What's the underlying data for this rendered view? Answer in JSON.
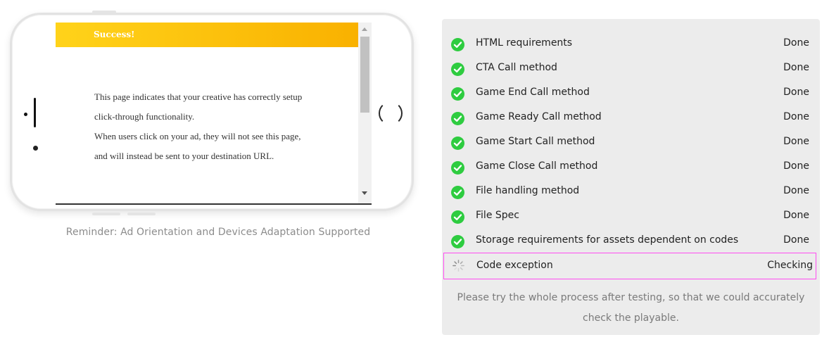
{
  "preview": {
    "header": "Success!",
    "body_lines": [
      "This page indicates that your creative has correctly setup",
      "click-through functionality.",
      "When users click on your ad, they will not see this page,",
      "and will instead be sent to your destination URL."
    ],
    "reminder": "Reminder: Ad Orientation and Devices Adaptation Supported"
  },
  "checks": {
    "items": [
      {
        "label": "HTML requirements",
        "status": "Done"
      },
      {
        "label": "CTA Call method",
        "status": "Done"
      },
      {
        "label": "Game End Call method",
        "status": "Done"
      },
      {
        "label": "Game Ready Call method",
        "status": "Done"
      },
      {
        "label": "Game Start Call method",
        "status": "Done"
      },
      {
        "label": "Game Close Call method",
        "status": "Done"
      },
      {
        "label": "File handling method",
        "status": "Done"
      },
      {
        "label": "File Spec",
        "status": "Done"
      },
      {
        "label": "Storage requirements for assets dependent on codes",
        "status": "Done"
      },
      {
        "label": "Code exception",
        "status": "Checking"
      }
    ],
    "note": "Please try the whole process after testing, so that we could accurately check the playable."
  },
  "colors": {
    "done": "#2ecc40",
    "checking_border": "#ff4cf0",
    "header_start": "#ffd31a",
    "header_end": "#f9b100"
  },
  "icons": {
    "done": "check-circle-icon",
    "checking": "spinner-icon"
  }
}
